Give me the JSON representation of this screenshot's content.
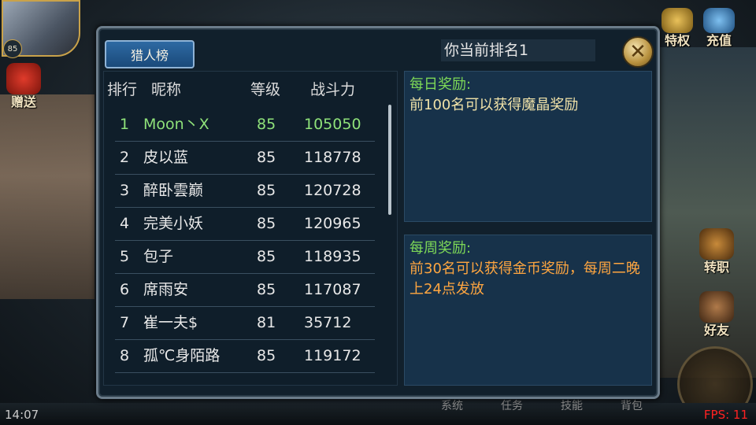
{
  "hud": {
    "avatar_level": "85",
    "gift_label": "赠送",
    "vip_label": "特权",
    "recharge_label": "充值",
    "transfer_label": "转职",
    "friends_label": "好友",
    "time": "14:07",
    "fps": "FPS: 11",
    "bottom_menu": [
      "系统",
      "任务",
      "技能",
      "背包"
    ]
  },
  "panel": {
    "tab_label": "猎人榜",
    "current_rank_text": "你当前排名1",
    "close_icon": "close-x-icon",
    "columns": [
      "排行",
      "昵称",
      "等级",
      "战斗力"
    ],
    "rows": [
      {
        "rank": "1",
        "name": "Moon丶X",
        "level": "85",
        "power": "105050"
      },
      {
        "rank": "2",
        "name": "皮以蓝",
        "level": "85",
        "power": "118778"
      },
      {
        "rank": "3",
        "name": "醉卧雲巅",
        "level": "85",
        "power": "120728"
      },
      {
        "rank": "4",
        "name": "完美小妖",
        "level": "85",
        "power": "120965"
      },
      {
        "rank": "5",
        "name": "包子",
        "level": "85",
        "power": "118935"
      },
      {
        "rank": "6",
        "name": "席雨安",
        "level": "85",
        "power": "117087"
      },
      {
        "rank": "7",
        "name": "崔一夫$",
        "level": "81",
        "power": "35712"
      },
      {
        "rank": "8",
        "name": "孤℃身陌路",
        "level": "85",
        "power": "119172"
      }
    ],
    "daily_reward": {
      "title": "每日奖励:",
      "text": "前100名可以获得魔晶奖励"
    },
    "weekly_reward": {
      "title": "每周奖励:",
      "text": "前30名可以获得金币奖励，每周二晚上24点发放"
    }
  },
  "colors": {
    "highlight_row": "#8fe27a",
    "reward_title": "#7ed957",
    "weekly_text": "#ffa640",
    "fps": "#ff2222"
  }
}
